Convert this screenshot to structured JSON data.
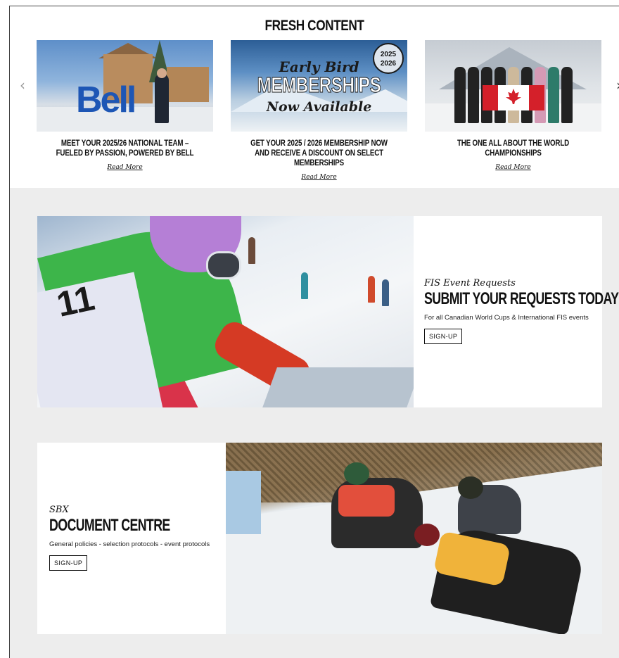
{
  "fresh": {
    "title": "FRESH CONTENT",
    "prev_arrow": "‹",
    "next_arrow": "›",
    "cards": [
      {
        "caption": "MEET YOUR 2025/26 NATIONAL TEAM – FUELED BY PASSION, POWERED BY BELL",
        "link": "Read More",
        "image_text": "Bell"
      },
      {
        "caption": "GET YOUR 2025 / 2026 MEMBERSHIP NOW AND RECEIVE A DISCOUNT ON SELECT MEMBERSHIPS",
        "link": "Read More",
        "image_line1": "Early Bird",
        "image_line2": "MEMBERSHIPS",
        "image_line3": "Now Available",
        "badge": "2025\n2026"
      },
      {
        "caption": "THE ONE ALL ABOUT THE WORLD CHAMPIONSHIPS",
        "link": "Read More"
      }
    ]
  },
  "promos": [
    {
      "kicker": "FIS Event Requests",
      "title": "SUBMIT YOUR REQUESTS TODAY!",
      "description": "For all Canadian World Cups & International FIS events",
      "button": "SIGN-UP",
      "photo_text": "11"
    },
    {
      "kicker": "SBX",
      "title": "DOCUMENT CENTRE",
      "description": "General policies - selection protocols - event protocols",
      "button": "SIGN-UP"
    }
  ],
  "colors": {
    "page_background": "#ededed",
    "card_background": "#ffffff",
    "text": "#111111",
    "bell_blue": "#1d56b5",
    "canada_red": "#d4202a"
  }
}
